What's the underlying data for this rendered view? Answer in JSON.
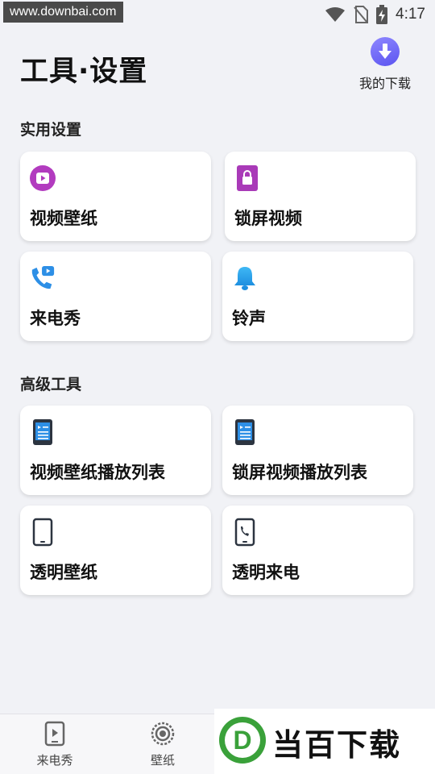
{
  "status_bar": {
    "watermark": "www.downbai.com",
    "time": "4:17"
  },
  "header": {
    "title": "工具·设置",
    "download_label": "我的下载"
  },
  "sections": [
    {
      "title": "实用设置",
      "cards": [
        {
          "label": "视频壁纸",
          "icon": "video-wallpaper-icon"
        },
        {
          "label": "锁屏视频",
          "icon": "lock-screen-icon"
        },
        {
          "label": "来电秀",
          "icon": "phone-video-icon"
        },
        {
          "label": "铃声",
          "icon": "bell-icon"
        }
      ]
    },
    {
      "title": "高级工具",
      "cards": [
        {
          "label": "视频壁纸播放列表",
          "icon": "tablet-playlist-icon"
        },
        {
          "label": "锁屏视频播放列表",
          "icon": "tablet-playlist-icon"
        },
        {
          "label": "透明壁纸",
          "icon": "phone-outline-icon"
        },
        {
          "label": "透明来电",
          "icon": "phone-call-outline-icon"
        }
      ]
    }
  ],
  "bottom_nav": [
    {
      "label": "来电秀",
      "icon": "video-play-icon"
    },
    {
      "label": "壁纸",
      "icon": "wallpaper-target-icon"
    }
  ],
  "overlay_logo": {
    "text": "当百下载",
    "letter": "D"
  },
  "colors": {
    "background": "#f1f2f6",
    "accent": "#6c63ff",
    "purple": "#b23bbf",
    "blue": "#2d8fe6"
  }
}
